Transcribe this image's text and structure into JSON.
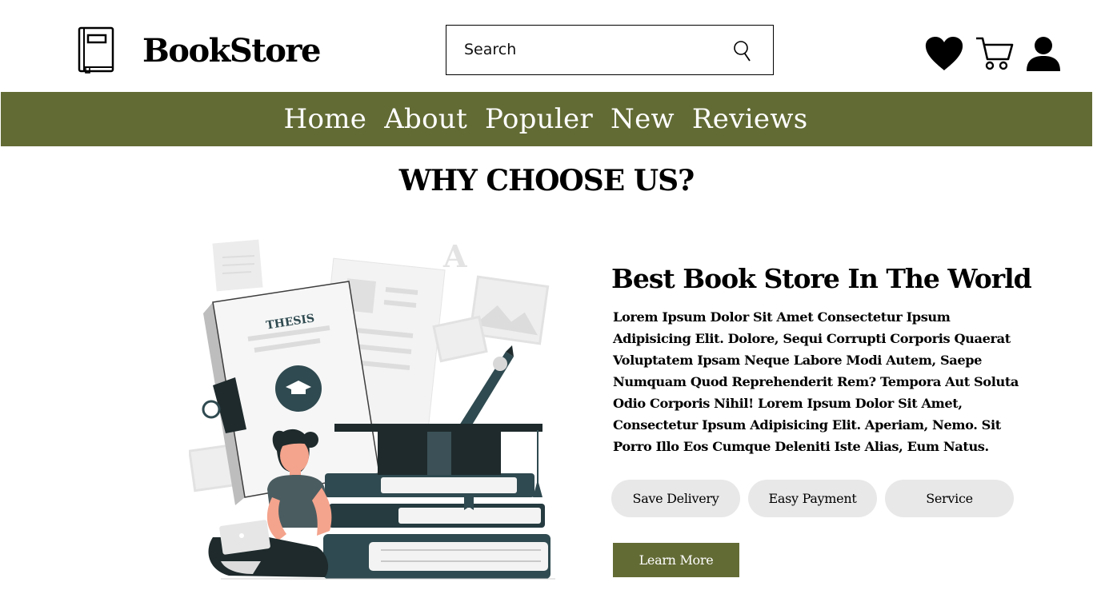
{
  "header": {
    "brand": "BookStore",
    "search_placeholder": "Search"
  },
  "icons": {
    "logo": "book-icon",
    "search": "search-icon",
    "wishlist": "heart-icon",
    "cart": "cart-icon",
    "account": "user-icon"
  },
  "nav": {
    "items": [
      "Home",
      "About",
      "Populer",
      "New",
      "Reviews"
    ]
  },
  "section": {
    "title": "WHY CHOOSE US?",
    "headline": "Best Book Store In The World",
    "body": "Lorem Ipsum Dolor Sit Amet Consectetur Ipsum Adipisicing Elit. Dolore, Sequi Corrupti Corporis Quaerat Voluptatem Ipsam Neque Labore Modi Autem, Saepe Numquam Quod Reprehenderit Rem? Tempora Aut Soluta Odio Corporis Nihil! Lorem Ipsum Dolor Sit Amet, Consectetur Ipsum Adipisicing Elit. Aperiam, Nemo. Sit Porro Illo Eos Cumque Deleniti Iste Alias, Eum Natus.",
    "features": [
      "Save Delivery",
      "Easy Payment",
      "Service"
    ],
    "cta": "Learn More"
  },
  "illustration": {
    "book_label": "THESIS",
    "letter": "A"
  },
  "colors": {
    "accent": "#636b35",
    "pill_bg": "#e8e8e8",
    "illustration_dark": "#2f4a50"
  }
}
